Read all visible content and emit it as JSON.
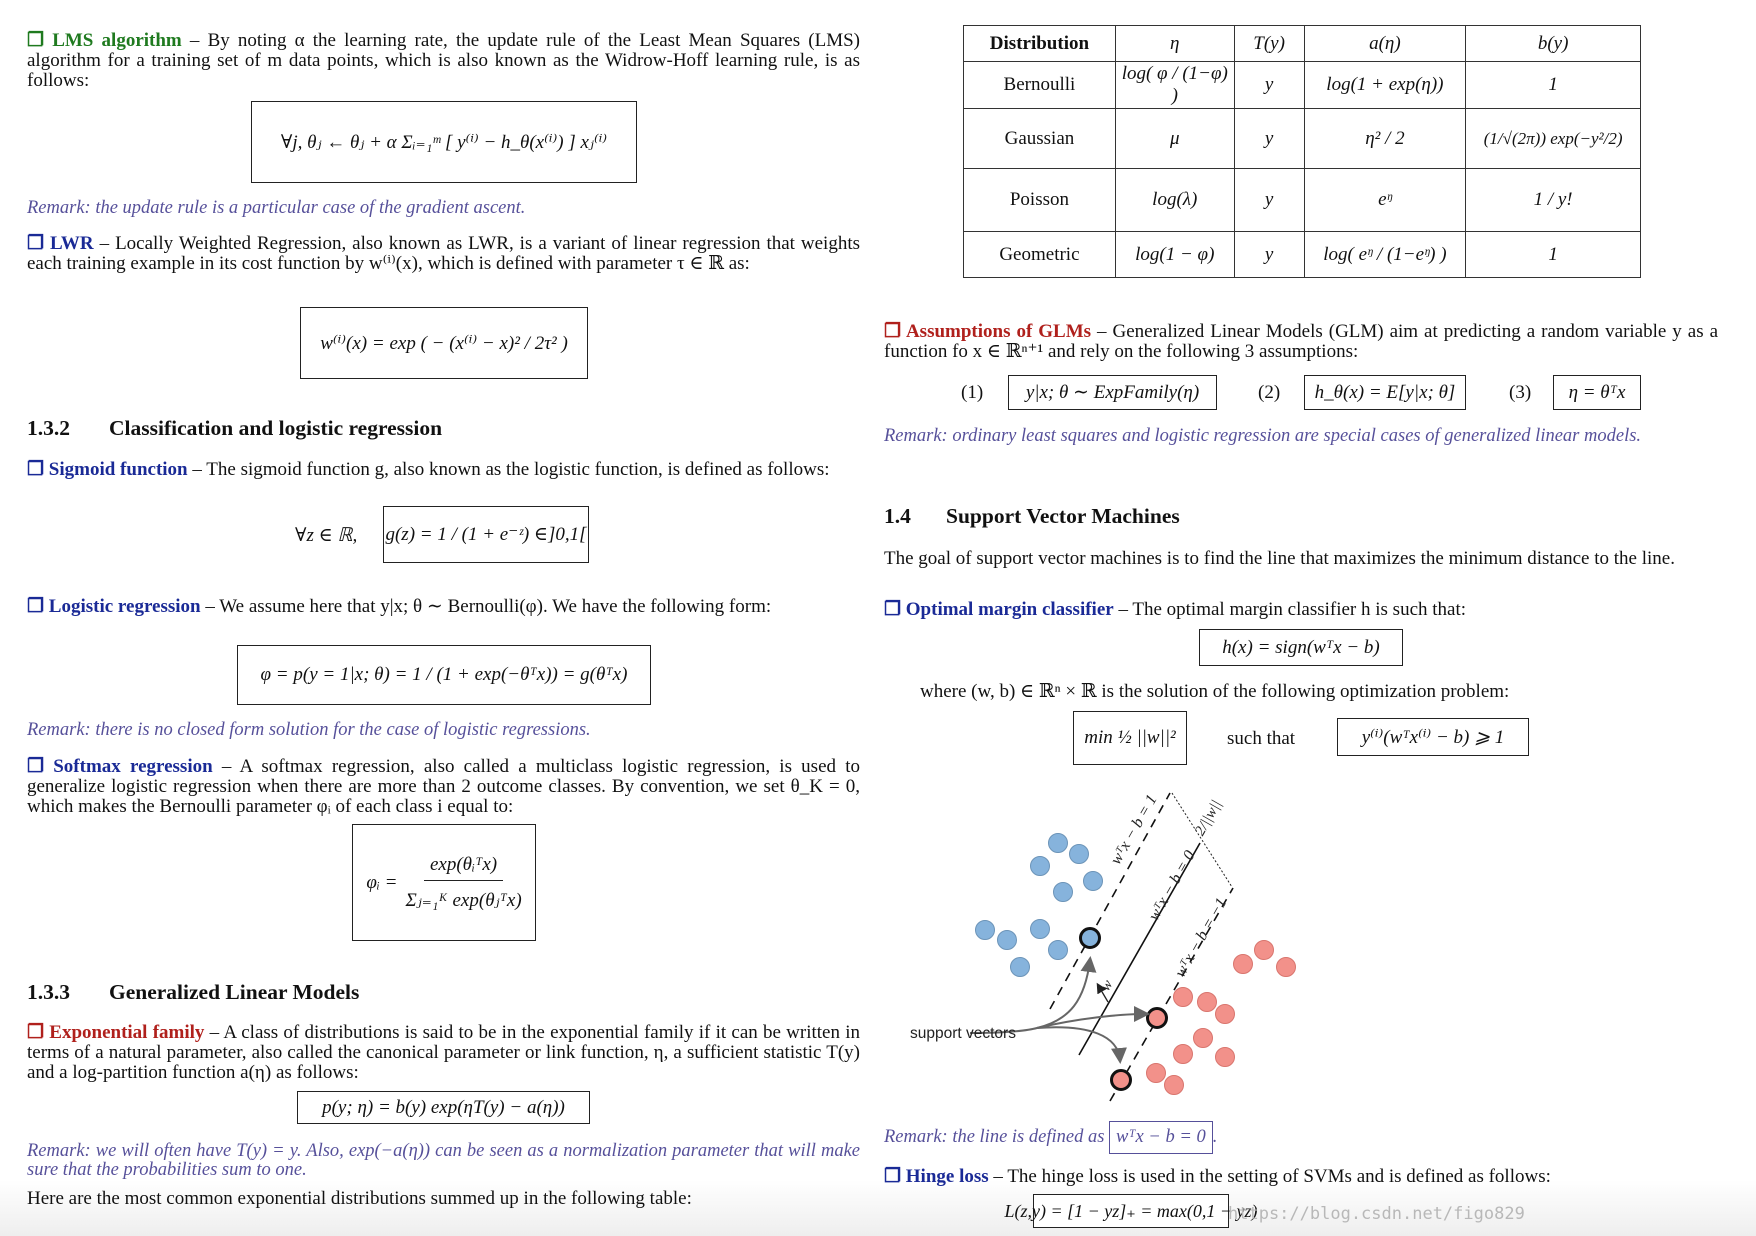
{
  "left": {
    "lms": {
      "title": "❐ LMS algorithm",
      "text": " – By noting α the learning rate, the update rule of the Least Mean Squares (LMS) algorithm for a training set of m data points, which is also known as the Widrow-Hoff learning rule, is as follows:",
      "formula": "∀j,   θⱼ ← θⱼ + α Σᵢ₌₁ᵐ [ y⁽ⁱ⁾ − h_θ(x⁽ⁱ⁾) ] xⱼ⁽ⁱ⁾",
      "remark": "Remark: the update rule is a particular case of the gradient ascent."
    },
    "lwr": {
      "title": "❐ LWR",
      "text": " – Locally Weighted Regression, also known as LWR, is a variant of linear regression that weights each training example in its cost function by w⁽ⁱ⁾(x), which is defined with parameter τ ∈ ℝ as:",
      "formula": "w⁽ⁱ⁾(x) = exp ( − (x⁽ⁱ⁾ − x)² / 2τ² )"
    },
    "section_132": {
      "number": "1.3.2",
      "title": "Classification and logistic regression"
    },
    "sigmoid": {
      "title": "❐ Sigmoid function",
      "text": " – The sigmoid function g, also known as the logistic function, is defined as follows:",
      "prefix": "∀z ∈ ℝ,",
      "formula": "g(z) = 1 / (1 + e⁻ᶻ) ∈]0,1["
    },
    "logistic": {
      "title": "❐ Logistic regression",
      "text": " – We assume here that y|x; θ ∼ Bernoulli(φ). We have the following form:",
      "formula": "φ = p(y = 1|x; θ) = 1 / (1 + exp(−θᵀx)) = g(θᵀx)",
      "remark": "Remark: there is no closed form solution for the case of logistic regressions."
    },
    "softmax": {
      "title": "❐ Softmax regression",
      "text": " – A softmax regression, also called a multiclass logistic regression, is used to generalize logistic regression when there are more than 2 outcome classes. By convention, we set θ_K = 0, which makes the Bernoulli parameter φᵢ of each class i equal to:",
      "formula_num": "exp(θᵢᵀx)",
      "formula_lhs": "φᵢ =",
      "formula_den": "Σⱼ₌₁ᴷ exp(θⱼᵀx)"
    },
    "section_133": {
      "number": "1.3.3",
      "title": "Generalized Linear Models"
    },
    "expfamily": {
      "title": "❐ Exponential family",
      "text": " – A class of distributions is said to be in the exponential family if it can be written in terms of a natural parameter, also called the canonical parameter or link function, η, a sufficient statistic T(y) and a log-partition function a(η) as follows:",
      "formula": "p(y; η) = b(y) exp(ηT(y) − a(η))",
      "remark": "Remark: we will often have T(y) = y. Also, exp(−a(η)) can be seen as a normalization parameter that will make sure that the probabilities sum to one."
    },
    "table_intro": "Here are the most common exponential distributions summed up in the following table:"
  },
  "right": {
    "table": {
      "headers": [
        "Distribution",
        "η",
        "T(y)",
        "a(η)",
        "b(y)"
      ],
      "rows": [
        [
          "Bernoulli",
          "log( φ / (1−φ) )",
          "y",
          "log(1 + exp(η))",
          "1"
        ],
        [
          "Gaussian",
          "μ",
          "y",
          "η² / 2",
          "(1/√(2π)) exp(−y²/2)"
        ],
        [
          "Poisson",
          "log(λ)",
          "y",
          "eᵑ",
          "1 / y!"
        ],
        [
          "Geometric",
          "log(1 − φ)",
          "y",
          "log( eᵑ / (1−eᵑ) )",
          "1"
        ]
      ]
    },
    "glm": {
      "title": "❐ Assumptions of GLMs",
      "text": " – Generalized Linear Models (GLM) aim at predicting a random variable y as a function fo x ∈ ℝⁿ⁺¹ and rely on the following 3 assumptions:",
      "assumptions": [
        {
          "label": "(1)",
          "formula": "y|x; θ ∼ ExpFamily(η)"
        },
        {
          "label": "(2)",
          "formula": "h_θ(x) = E[y|x; θ]"
        },
        {
          "label": "(3)",
          "formula": "η = θᵀx"
        }
      ],
      "remark": "Remark: ordinary least squares and logistic regression are special cases of generalized linear models."
    },
    "section_14": {
      "number": "1.4",
      "title": "Support Vector Machines"
    },
    "svm_intro": "The goal of support vector machines is to find the line that maximizes the minimum distance to the line.",
    "omc": {
      "title": "❐ Optimal margin classifier",
      "text": " – The optimal margin classifier h is such that:",
      "formula": "h(x) = sign(wᵀx − b)",
      "where": "where (w, b) ∈ ℝⁿ × ℝ is the solution of the following optimization problem:",
      "min_formula": "min ½ ||w||²",
      "such_that": "such that",
      "constraint": "y⁽ⁱ⁾(wᵀx⁽ⁱ⁾ − b) ⩾ 1"
    },
    "figure": {
      "support_label": "support vectors",
      "line_labels": {
        "plus": "wᵀx − b = 1",
        "zero": "wᵀx − b = 0",
        "minus": "wᵀx − b = −1",
        "margin": "2/||w||",
        "w": "w"
      },
      "colors": {
        "blue": "#86b3dc",
        "red": "#f2918a"
      }
    },
    "line_remark": {
      "text": "Remark: the line is defined as ",
      "formula": "wᵀx − b = 0",
      "end": "."
    },
    "hinge": {
      "title": "❐ Hinge loss",
      "text": " – The hinge loss is used in the setting of SVMs and is defined as follows:",
      "formula": "L(z,y) = [1 − yz]₊ = max(0,1 − yz)"
    }
  },
  "watermark": "https://blog.csdn.net/figo829"
}
